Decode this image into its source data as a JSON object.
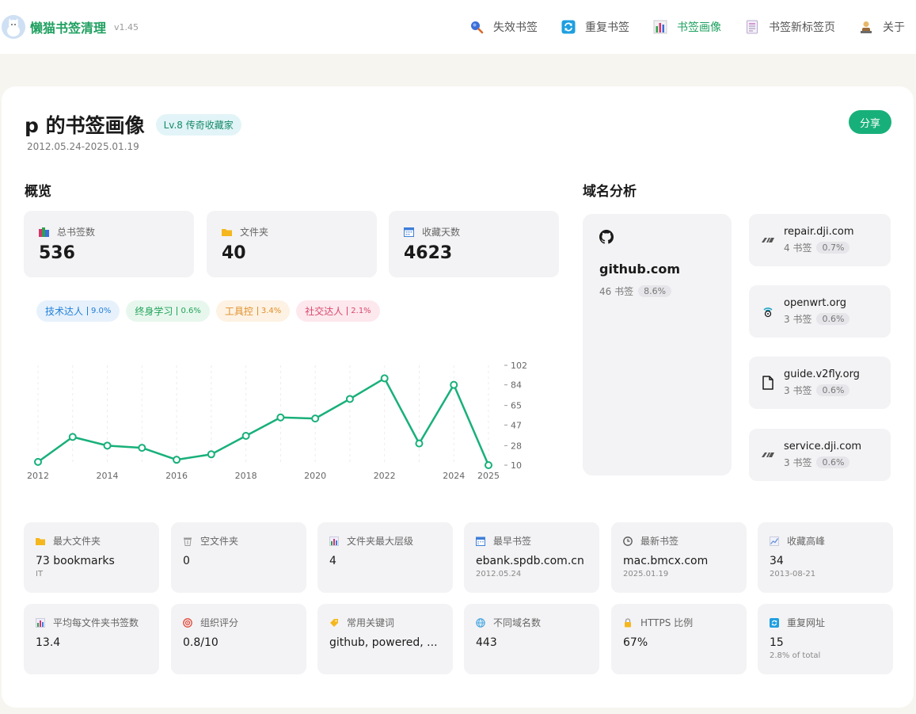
{
  "header": {
    "app_name": "懒猫书签清理",
    "version": "v1.45",
    "nav": [
      {
        "label": "失效书签",
        "icon": "magnifier-icon"
      },
      {
        "label": "重复书签",
        "icon": "refresh-icon"
      },
      {
        "label": "书签画像",
        "icon": "bar-chart-icon",
        "active": true
      },
      {
        "label": "书签新标签页",
        "icon": "document-icon"
      },
      {
        "label": "关于",
        "icon": "person-icon"
      }
    ]
  },
  "profile": {
    "title": "p 的书签画像",
    "level": "Lv.8  传奇收藏家",
    "date_range": "2012.05.24-2025.01.19",
    "share_label": "分享"
  },
  "overview": {
    "title": "概览",
    "stats": [
      {
        "label": "总书签数",
        "value": "536",
        "icon": "books-icon"
      },
      {
        "label": "文件夹",
        "value": "40",
        "icon": "folder-icon"
      },
      {
        "label": "收藏天数",
        "value": "4623",
        "icon": "calendar-icon"
      }
    ],
    "tags": [
      {
        "label": "技术达人",
        "pct": "9.0%",
        "fg": "#1f7fd6",
        "bg": "#e7f1fc"
      },
      {
        "label": "终身学习",
        "pct": "0.6%",
        "fg": "#22a45a",
        "bg": "#e8f7ee"
      },
      {
        "label": "工具控",
        "pct": "3.4%",
        "fg": "#e0902a",
        "bg": "#fdf2e3"
      },
      {
        "label": "社交达人",
        "pct": "2.1%",
        "fg": "#d8476b",
        "bg": "#fde8ee"
      }
    ]
  },
  "chart_data": {
    "type": "line",
    "x": [
      2012,
      2013,
      2014,
      2015,
      2016,
      2017,
      2018,
      2019,
      2020,
      2021,
      2022,
      2023,
      2024,
      2025
    ],
    "values": [
      13,
      36,
      28,
      26,
      15,
      20,
      37,
      54,
      53,
      71,
      90,
      30,
      84,
      10
    ],
    "x_ticks": [
      "2012",
      "2014",
      "2016",
      "2018",
      "2020",
      "2022",
      "2024",
      "2025"
    ],
    "y_ticks": [
      "102",
      "84",
      "65",
      "47",
      "28",
      "10"
    ],
    "ylim": [
      10,
      102
    ],
    "line_color": "#18b07a",
    "y_axis_position": "right",
    "grid": "vertical dashed"
  },
  "domains": {
    "title": "域名分析",
    "top": {
      "name": "github.com",
      "count": "46 书签",
      "pct": "8.6%",
      "icon": "github-icon"
    },
    "others": [
      {
        "name": "repair.dji.com",
        "count": "4 书签",
        "pct": "0.7%",
        "icon": "dji-icon"
      },
      {
        "name": "openwrt.org",
        "count": "3 书签",
        "pct": "0.6%",
        "icon": "openwrt-icon"
      },
      {
        "name": "guide.v2fly.org",
        "count": "3 书签",
        "pct": "0.6%",
        "icon": "file-icon"
      },
      {
        "name": "service.dji.com",
        "count": "3 书签",
        "pct": "0.6%",
        "icon": "dji-icon"
      }
    ]
  },
  "details": [
    {
      "label": "最大文件夹",
      "value": "73 bookmarks",
      "sub": "IT",
      "icon": "folder-icon",
      "color": "#f5b71e"
    },
    {
      "label": "空文件夹",
      "value": "0",
      "sub": "",
      "icon": "trash-icon",
      "color": "#9a9a9a"
    },
    {
      "label": "文件夹最大层级",
      "value": "4",
      "sub": "",
      "icon": "bar-chart-icon",
      "color": "#3e7fd8"
    },
    {
      "label": "最早书签",
      "value": "ebank.spdb.com.cn",
      "sub": "2012.05.24",
      "icon": "calendar-icon",
      "color": "#3e7fd8"
    },
    {
      "label": "最新书签",
      "value": "mac.bmcx.com",
      "sub": "2025.01.19",
      "icon": "clock-icon",
      "color": "#555555"
    },
    {
      "label": "收藏高峰",
      "value": "34",
      "sub": "2013-08-21",
      "icon": "trend-icon",
      "color": "#6a8fd8"
    },
    {
      "label": "平均每文件夹书签数",
      "value": "13.4",
      "sub": "",
      "icon": "bar-chart-icon",
      "color": "#3e7fd8"
    },
    {
      "label": "组织评分",
      "value": "0.8/10",
      "sub": "",
      "icon": "target-icon",
      "color": "#e04a3a"
    },
    {
      "label": "常用关键词",
      "value": "github, powered, ...",
      "sub": "",
      "icon": "tag-icon",
      "color": "#f5b71e"
    },
    {
      "label": "不同域名数",
      "value": "443",
      "sub": "",
      "icon": "globe-icon",
      "color": "#3e9fd8"
    },
    {
      "label": "HTTPS 比例",
      "value": "67%",
      "sub": "",
      "icon": "lock-icon",
      "color": "#f5b71e"
    },
    {
      "label": "重复网址",
      "value": "15",
      "sub": "2.8% of total",
      "icon": "refresh-icon",
      "color": "#1e9fe0"
    }
  ]
}
